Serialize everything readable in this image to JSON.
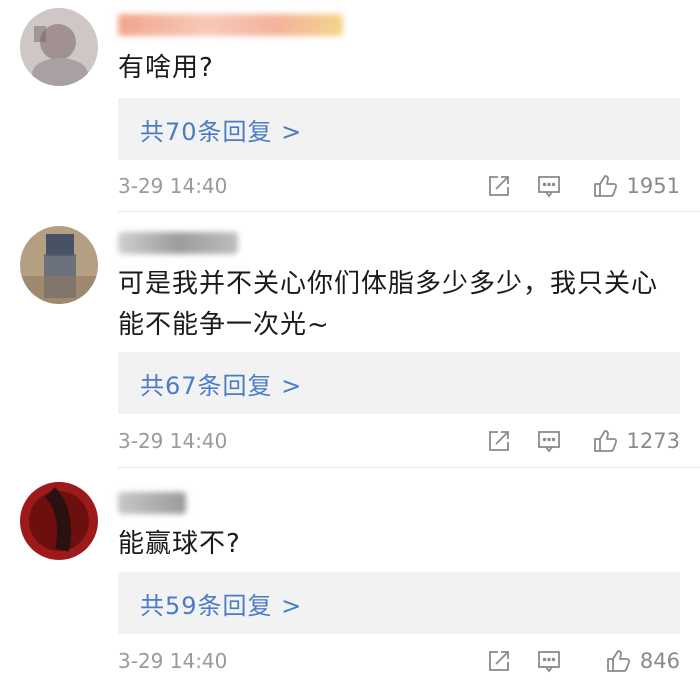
{
  "comments": [
    {
      "text": "有啥用?",
      "reply_label": "共70条回复 >",
      "date": "3-29 14:40",
      "likes": "1951",
      "avatar_color": "#b8a7a7"
    },
    {
      "text": "可是我并不关心你们体脂多少多少，我只关心能不能争一次光~",
      "reply_label": "共67条回复 >",
      "date": "3-29 14:40",
      "likes": "1273",
      "avatar_color": "#8a7a66"
    },
    {
      "text": "能赢球不?",
      "reply_label": "共59条回复 >",
      "date": "3-29 14:40",
      "likes": "846",
      "avatar_color": "#8c1414"
    }
  ],
  "icons": {
    "forward": "forward-icon",
    "comment": "comment-icon",
    "like": "thumbs-up-icon"
  },
  "colors": {
    "link": "#4a7cc6",
    "meta": "#9a9a9a",
    "reply_bg": "#f2f2f2"
  }
}
